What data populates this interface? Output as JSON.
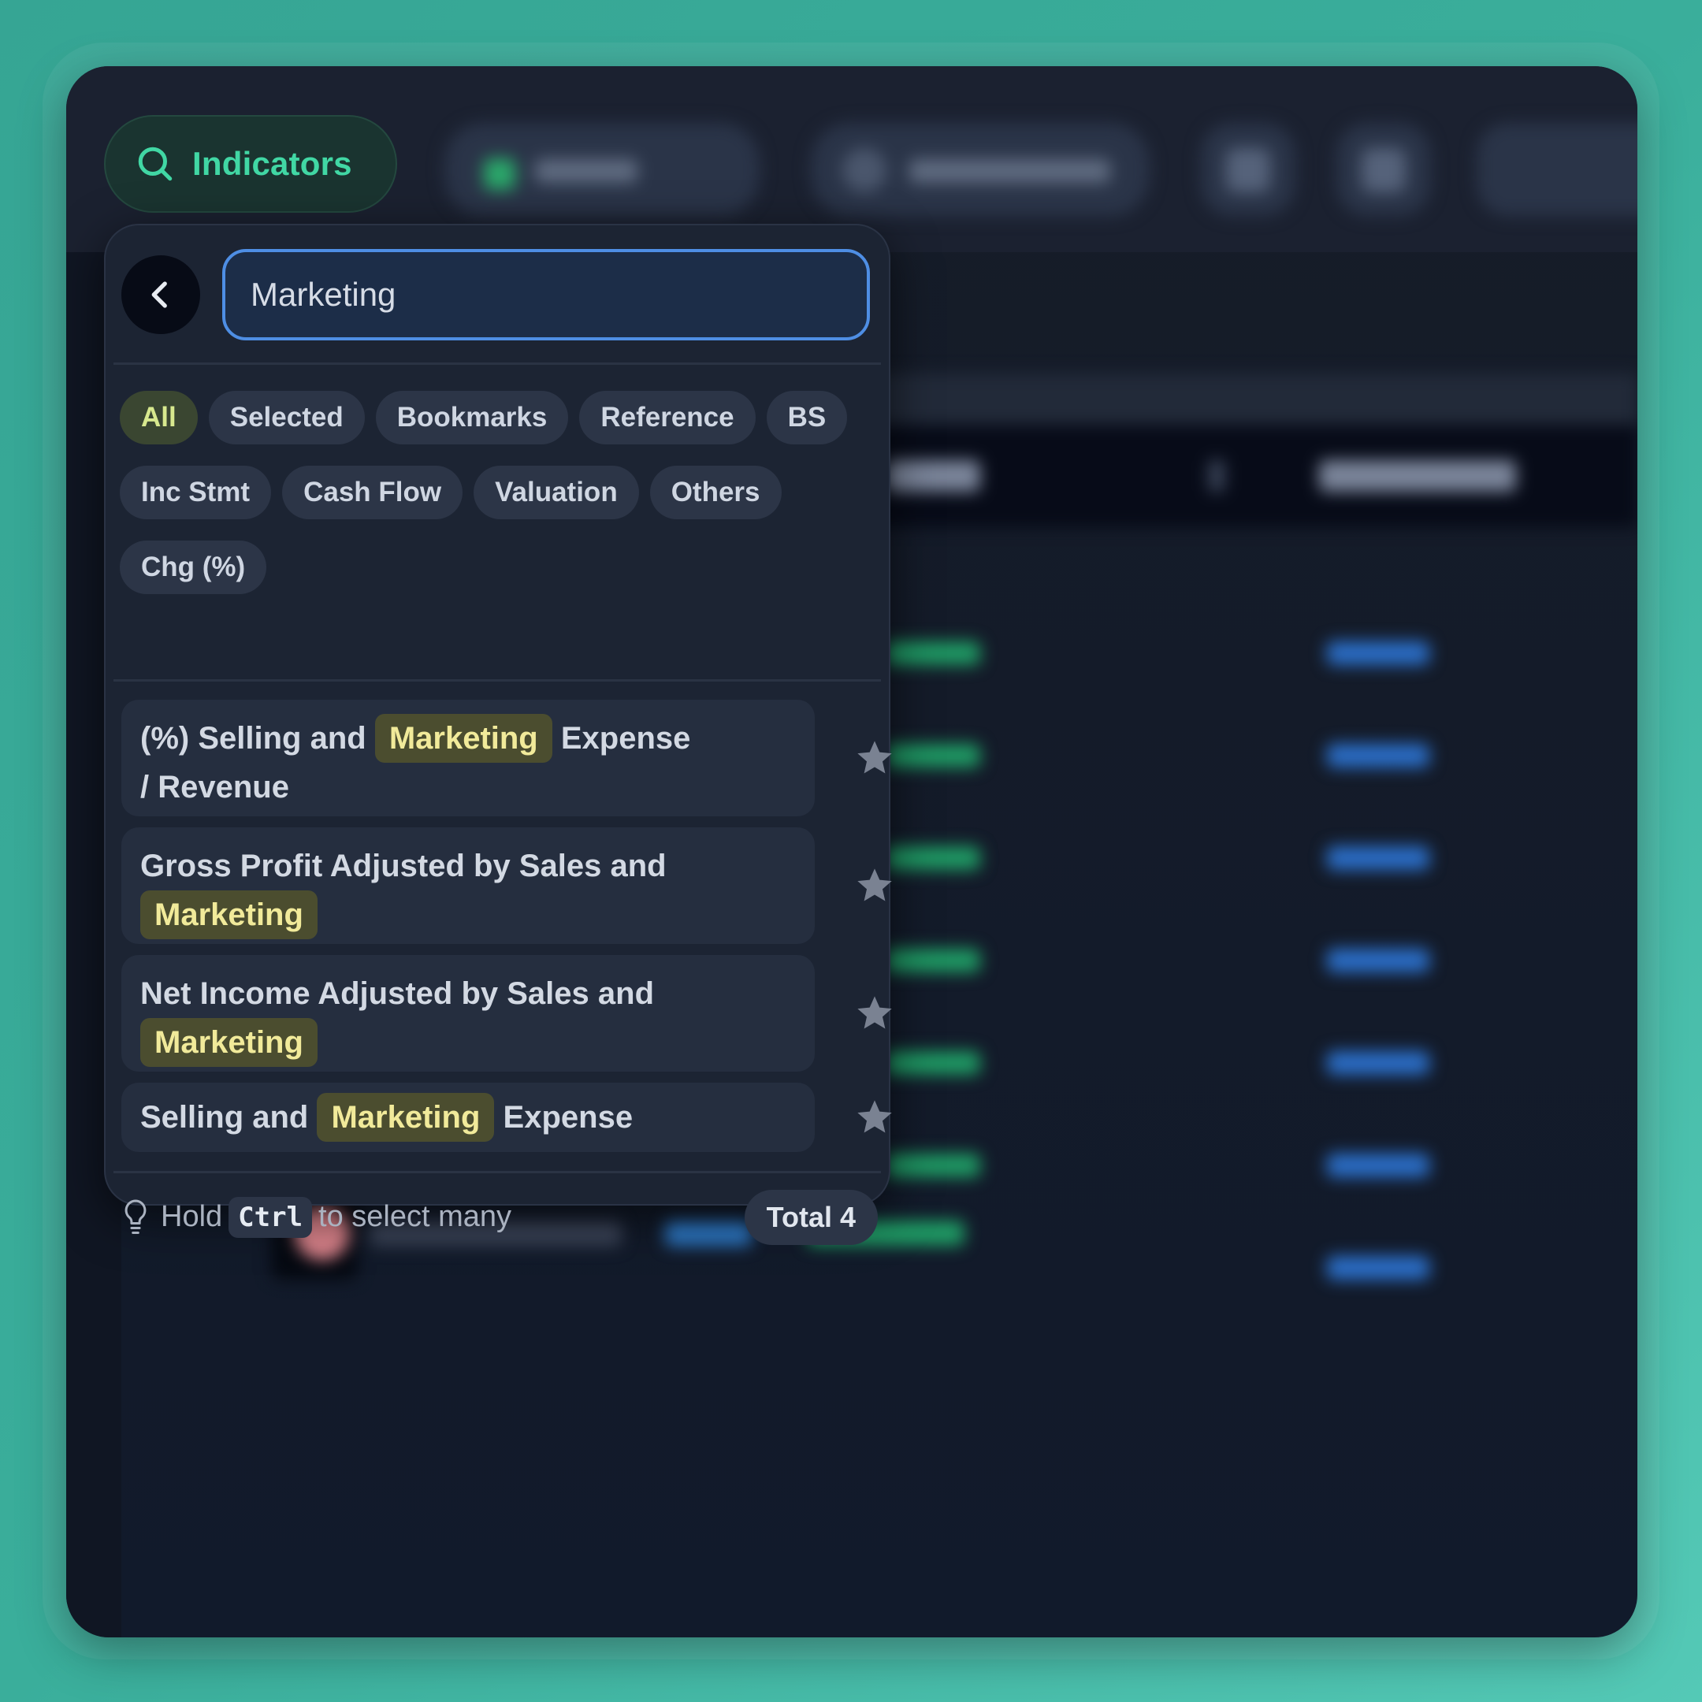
{
  "toolbar": {
    "indicators_label": "Indicators"
  },
  "search": {
    "value": "Marketing",
    "placeholder": ""
  },
  "filters": [
    {
      "label": "All",
      "active": true
    },
    {
      "label": "Selected"
    },
    {
      "label": "Bookmarks"
    },
    {
      "label": "Reference"
    },
    {
      "label": "BS"
    },
    {
      "label": "Inc Stmt"
    },
    {
      "label": "Cash Flow"
    },
    {
      "label": "Valuation"
    },
    {
      "label": "Others"
    },
    {
      "label": "Chg (%)"
    }
  ],
  "results": [
    {
      "pre": "(%) Selling and",
      "highlight": "Marketing",
      "post": "Expense",
      "post2": "/ Revenue"
    },
    {
      "pre": "Gross Profit Adjusted by Sales and",
      "highlight": "Marketing"
    },
    {
      "pre": "Net Income Adjusted by Sales and",
      "highlight": "Marketing"
    },
    {
      "pre": "Selling and",
      "highlight": "Marketing",
      "post": "Expense"
    }
  ],
  "footer": {
    "hint_pre": "Hold",
    "hint_key": "Ctrl",
    "hint_post": "to select many",
    "total": "Total 4"
  },
  "colors": {
    "accent_green": "#41d7a4",
    "highlight_text": "#f1ea9a",
    "search_border": "#4e8ee4"
  },
  "icons": [
    "search-icon",
    "chevron-left-icon",
    "star-icon",
    "lightbulb-icon"
  ]
}
